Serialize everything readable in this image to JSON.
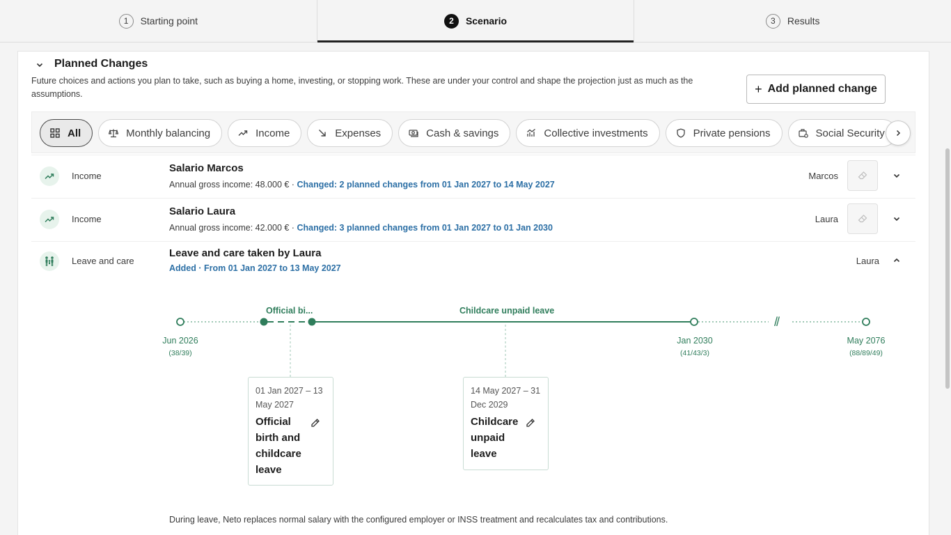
{
  "stepper": {
    "steps": [
      {
        "num": "1",
        "label": "Starting point"
      },
      {
        "num": "2",
        "label": "Scenario"
      },
      {
        "num": "3",
        "label": "Results"
      }
    ]
  },
  "section": {
    "title": "Planned Changes",
    "description": "Future choices and actions you plan to take, such as buying a home, investing, or stopping work. These are under your control and shape the projection just as much as the assumptions.",
    "add_button": "Add planned change"
  },
  "filters": [
    {
      "label": "All",
      "icon": "grid-icon",
      "active": true
    },
    {
      "label": "Monthly balancing",
      "icon": "scale-icon"
    },
    {
      "label": "Income",
      "icon": "trend-up-icon"
    },
    {
      "label": "Expenses",
      "icon": "arrow-down-right-icon"
    },
    {
      "label": "Cash & savings",
      "icon": "cash-icon"
    },
    {
      "label": "Collective investments",
      "icon": "bar-chart-icon"
    },
    {
      "label": "Private pensions",
      "icon": "shield-icon"
    },
    {
      "label": "Social Security",
      "icon": "briefcase-icon"
    }
  ],
  "rows": [
    {
      "category": "Income",
      "title": "Salario Marcos",
      "sub_prefix": "Annual gross income: 48.000 € · ",
      "sub_change": "Changed: 2 planned changes from 01 Jan 2027 to 14 May 2027",
      "owner": "Marcos"
    },
    {
      "category": "Income",
      "title": "Salario Laura",
      "sub_prefix": "Annual gross income: 42.000 € · ",
      "sub_change": "Changed: 3 planned changes from 01 Jan 2027 to 01 Jan 2030",
      "owner": "Laura"
    },
    {
      "category": "Leave and care",
      "title": "Leave and care taken by Laura",
      "sub_change": "Added · From 01 Jan 2027 to 13 May 2027",
      "owner": "Laura"
    }
  ],
  "timeline": {
    "segment_labels": [
      "Official bi...",
      "Childcare unpaid leave"
    ],
    "markers": [
      {
        "date": "Jun 2026",
        "ages": "(38/39)"
      },
      {
        "date": "Jan 2030",
        "ages": "(41/43/3)"
      },
      {
        "date": "May 2076",
        "ages": "(88/89/49)"
      }
    ],
    "break_mark": "//",
    "cards": [
      {
        "dates": "01 Jan 2027 – 13 May 2027",
        "name": "Official birth and childcare leave"
      },
      {
        "dates": "14 May 2027 – 31 Dec 2029",
        "name": "Childcare unpaid leave"
      }
    ]
  },
  "note": "During leave, Neto replaces normal salary with the configured employer or INSS treatment and recalculates tax and contributions.",
  "colors": {
    "accent_green": "#2f7d5b",
    "link_blue": "#2c6fa5"
  }
}
